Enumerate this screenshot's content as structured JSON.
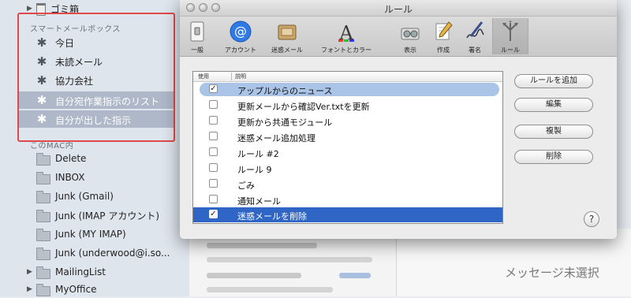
{
  "sidebar": {
    "trash_label": "ゴミ箱",
    "smart_header": "スマートメールボックス",
    "smart_items": [
      {
        "label": "今日",
        "selected": false
      },
      {
        "label": "未読メール",
        "selected": false
      },
      {
        "label": "協力会社",
        "selected": false
      },
      {
        "label": "自分宛作業指示のリスト",
        "selected": true
      },
      {
        "label": "自分が出した指示",
        "selected": true
      }
    ],
    "mac_header": "このMAC内",
    "folders": [
      {
        "label": "Delete",
        "disclosure": false
      },
      {
        "label": "INBOX",
        "disclosure": false
      },
      {
        "label": "Junk (Gmail)",
        "disclosure": false
      },
      {
        "label": "Junk (IMAP アカウント)",
        "disclosure": false
      },
      {
        "label": "Junk (MY IMAP)",
        "disclosure": false
      },
      {
        "label": "Junk (underwood@i.so...",
        "disclosure": false
      },
      {
        "label": "MailingList",
        "disclosure": true
      },
      {
        "label": "MyOffice",
        "disclosure": true
      }
    ],
    "highlight_color": "#e0484c"
  },
  "no_selection_text": "メッセージ未選択",
  "window": {
    "title": "ルール",
    "toolbar": [
      {
        "label": "一般",
        "icon": "general-switch-icon"
      },
      {
        "label": "アカウント",
        "icon": "at-sign-icon"
      },
      {
        "label": "迷惑メール",
        "icon": "junk-mail-icon"
      },
      {
        "label": "フォントとカラー",
        "icon": "font-color-icon"
      },
      {
        "label": "表示",
        "icon": "display-icon"
      },
      {
        "label": "作成",
        "icon": "compose-pencil-icon"
      },
      {
        "label": "署名",
        "icon": "signature-pen-icon"
      },
      {
        "label": "ルール",
        "icon": "rules-icon",
        "selected": true
      }
    ],
    "table": {
      "col_use": "使用",
      "col_desc": "説明",
      "rows": [
        {
          "label": "アップルからのニュース",
          "checked": true,
          "state": "highlight"
        },
        {
          "label": "更新メールから確認Ver.txtを更新",
          "checked": false,
          "state": "normal"
        },
        {
          "label": "更新から共通モジュール",
          "checked": false,
          "state": "normal"
        },
        {
          "label": "迷惑メール追加処理",
          "checked": false,
          "state": "normal"
        },
        {
          "label": "ルール #2",
          "checked": false,
          "state": "normal"
        },
        {
          "label": "ルール 9",
          "checked": false,
          "state": "normal"
        },
        {
          "label": "ごみ",
          "checked": false,
          "state": "normal"
        },
        {
          "label": "通知メール",
          "checked": false,
          "state": "normal"
        },
        {
          "label": "迷惑メールを削除",
          "checked": true,
          "state": "selected"
        }
      ]
    },
    "buttons": {
      "add_rule": "ルールを追加",
      "edit": "編集",
      "duplicate": "複製",
      "delete": "削除",
      "help": "?"
    }
  }
}
